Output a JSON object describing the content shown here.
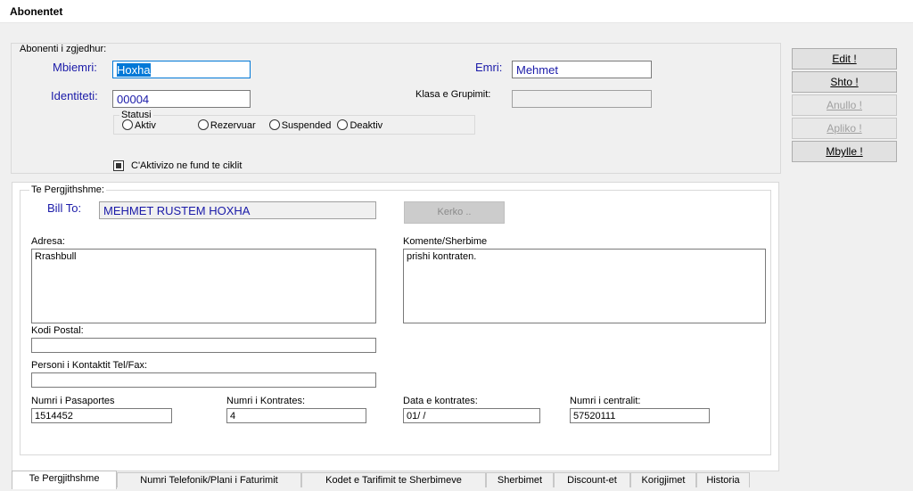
{
  "window": {
    "title": "Abonentet"
  },
  "selected": {
    "legend": "Abonenti i zgjedhur:",
    "mbiemri_label": "Mbiemri:",
    "mbiemri_value": "Hoxha",
    "emri_label": "Emri:",
    "emri_value": "Mehmet",
    "identiteti_label": "Identiteti:",
    "identiteti_value": "00004",
    "klasa_label": "Klasa e Grupimit:",
    "klasa_value": "",
    "statusi": {
      "legend": "Statusi",
      "options": [
        "Aktiv",
        "Rezervuar",
        "Suspended",
        "Deaktiv"
      ]
    },
    "aktivizo_label": "C'Aktivizo ne fund te ciklit"
  },
  "buttons": {
    "edit": "Edit !",
    "shto": "Shto !",
    "anullo": "Anullo !",
    "apliko": "Apliko !",
    "mbylle": "Mbylle !"
  },
  "general": {
    "legend": "Te Pergjithshme:",
    "bill_to_label": "Bill To:",
    "bill_to_value": "MEHMET RUSTEM HOXHA",
    "kerko_button": "Kerko ..",
    "adresa_label": "Adresa:",
    "adresa_value": "Rrashbull",
    "komente_label": "Komente/Sherbime",
    "komente_value": "prishi kontraten.",
    "kodi_postal_label": "Kodi Postal:",
    "kodi_postal_value": "",
    "personi_label": "Personi i Kontaktit Tel/Fax:",
    "personi_value": "",
    "pasaporta_label": "Numri i Pasaportes",
    "pasaporta_value": "1514452",
    "kontrata_label": "Numri i Kontrates:",
    "kontrata_value": "4",
    "data_label": "Data e kontrates:",
    "data_value": "01/  /",
    "centrali_label": "Numri i centralit:",
    "centrali_value": "57520111"
  },
  "tabs": [
    "Te Pergjithshme",
    "Numri Telefonik/Plani i Faturimit",
    "Kodet e Tarifimit te Sherbimeve",
    "Sherbimet",
    "Discount-et",
    "Korigjimet",
    "Historia"
  ]
}
